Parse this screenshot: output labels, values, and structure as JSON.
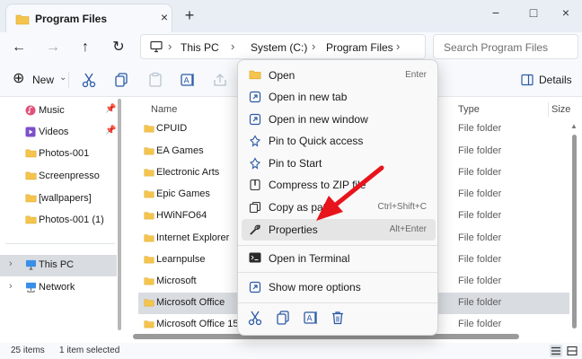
{
  "tab": {
    "title": "Program Files",
    "close_glyph": "×",
    "new_tab_glyph": "+"
  },
  "window_controls": {
    "minimize": "−",
    "maximize": "□",
    "close": "×"
  },
  "nav": {
    "back": "←",
    "forward": "→",
    "up": "↑",
    "refresh": "↻"
  },
  "breadcrumb": [
    "This PC",
    "System (C:)",
    "Program Files"
  ],
  "breadcrumb_sep": "›",
  "search": {
    "placeholder": "Search Program Files"
  },
  "commandbar": {
    "new_label": "New",
    "new_chevron": "⌄",
    "details_label": "Details"
  },
  "sidebar": {
    "items": [
      {
        "label": "Music",
        "icon": "music-icon",
        "pinned": true
      },
      {
        "label": "Videos",
        "icon": "videos-icon",
        "pinned": true
      },
      {
        "label": "Photos-001",
        "icon": "folder-icon"
      },
      {
        "label": "Screenpresso",
        "icon": "folder-icon"
      },
      {
        "label": "[wallpapers]",
        "icon": "folder-icon"
      },
      {
        "label": "Photos-001 (1)",
        "icon": "folder-icon"
      },
      {
        "label": "This PC",
        "icon": "pc-icon",
        "selected": true
      },
      {
        "label": "Network",
        "icon": "network-icon"
      }
    ],
    "pin_glyph": "📌",
    "expander": "›"
  },
  "filelist": {
    "columns": {
      "name": "Name",
      "type": "Type",
      "size": "Size"
    },
    "rows": [
      {
        "name": "CPUID",
        "type": "File folder"
      },
      {
        "name": "EA Games",
        "type": "File folder"
      },
      {
        "name": "Electronic Arts",
        "type": "File folder"
      },
      {
        "name": "Epic Games",
        "type": "File folder"
      },
      {
        "name": "HWiNFO64",
        "type": "File folder"
      },
      {
        "name": "Internet Explorer",
        "type": "File folder"
      },
      {
        "name": "Learnpulse",
        "type": "File folder"
      },
      {
        "name": "Microsoft",
        "type": "File folder"
      },
      {
        "name": "Microsoft Office",
        "type": "File folder",
        "selected": true
      },
      {
        "name": "Microsoft Office 15",
        "type": "File folder"
      }
    ]
  },
  "status": {
    "items": "25 items",
    "selected": "1 item selected"
  },
  "context_menu": {
    "items": [
      {
        "label": "Open",
        "shortcut": "Enter",
        "icon": "open-folder-icon"
      },
      {
        "label": "Open in new tab",
        "shortcut": "",
        "icon": "new-tab-icon"
      },
      {
        "label": "Open in new window",
        "shortcut": "",
        "icon": "new-window-icon"
      },
      {
        "label": "Pin to Quick access",
        "shortcut": "",
        "icon": "pin-icon"
      },
      {
        "label": "Pin to Start",
        "shortcut": "",
        "icon": "pin-start-icon"
      },
      {
        "label": "Compress to ZIP file",
        "shortcut": "",
        "icon": "zip-icon"
      },
      {
        "label": "Copy as path",
        "shortcut": "Ctrl+Shift+C",
        "icon": "copy-path-icon"
      },
      {
        "label": "Properties",
        "shortcut": "Alt+Enter",
        "icon": "wrench-icon"
      },
      {
        "label": "Open in Terminal",
        "shortcut": "",
        "icon": "terminal-icon"
      },
      {
        "label": "Show more options",
        "shortcut": "",
        "icon": "more-options-icon"
      }
    ]
  },
  "colors": {
    "folder": "#f4c44e",
    "accent": "#0067c0",
    "annotation_arrow": "#e8141c",
    "selection": "#d9dde2"
  }
}
